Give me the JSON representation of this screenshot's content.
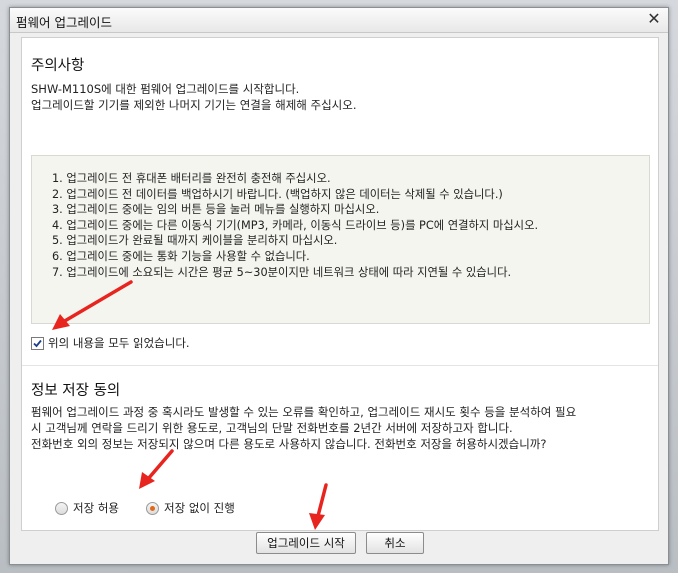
{
  "window": {
    "title": "펌웨어 업그레이드",
    "close_icon": "close-icon"
  },
  "notice": {
    "heading": "주의사항",
    "intro_line1": "SHW-M110S에 대한 펌웨어 업그레이드를 시작합니다.",
    "intro_line2": "업그레이드할 기기를 제외한 나머지 기기는 연결을 해제해 주십시오.",
    "items": [
      "1. 업그레이드 전 휴대폰 배터리를 완전히 충전해 주십시오.",
      "2. 업그레이드 전 데이터를 백업하시기 바랍니다. (백업하지 않은 데이터는 삭제될 수 있습니다.)",
      "3. 업그레이드 중에는 임의 버튼 등을 눌러 메뉴를 실행하지 마십시오.",
      "4. 업그레이드 중에는 다른 이동식 기기(MP3, 카메라, 이동식 드라이브 등)를 PC에 연결하지 마십시오.",
      "5. 업그레이드가 완료될 때까지 케이블을 분리하지 마십시오.",
      "6. 업그레이드 중에는 통화 기능을 사용할 수 없습니다.",
      "7. 업그레이드에 소요되는 시간은 평균 5~30분이지만 네트워크 상태에 따라 지연될 수 있습니다."
    ],
    "read_checkbox_label": "위의 내용을 모두 읽었습니다.",
    "read_checked": true
  },
  "consent": {
    "heading": "정보 저장 동의",
    "line1": "펌웨어 업그레이드 과정 중 혹시라도 발생할 수 있는 오류를 확인하고, 업그레이드 재시도 횟수 등을 분석하여 필요",
    "line2": "시 고객님께 연락을 드리기 위한 용도로, 고객님의 단말 전화번호를 2년간 서버에 저장하고자 합니다.",
    "line3": "전화번호 외의 정보는 저장되지 않으며 다른 용도로 사용하지 않습니다. 전화번호 저장을 허용하시겠습니까?",
    "options": [
      {
        "label": "저장 허용",
        "selected": false
      },
      {
        "label": "저장 없이 진행",
        "selected": true
      }
    ]
  },
  "buttons": {
    "start_label": "업그레이드 시작",
    "cancel_label": "취소"
  },
  "colors": {
    "accent_radio": "#e06a1a",
    "annotation_arrow": "#e8241f"
  }
}
